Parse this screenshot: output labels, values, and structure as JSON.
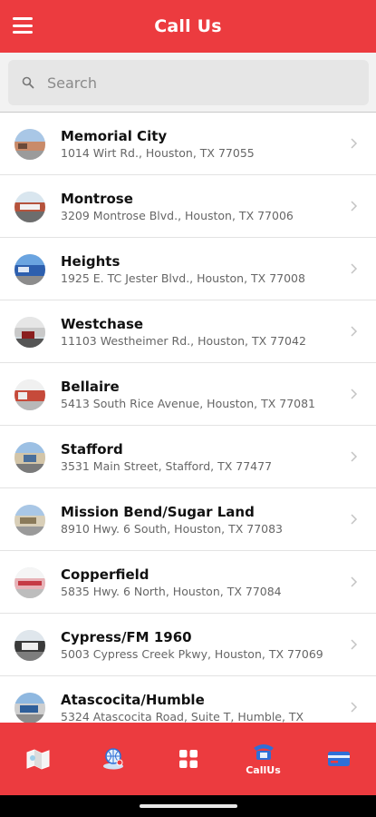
{
  "header": {
    "title": "Call Us"
  },
  "search": {
    "placeholder": "Search"
  },
  "locations": [
    {
      "name": "Memorial City",
      "address": "1014 Wirt Rd., Houston, TX 77055"
    },
    {
      "name": "Montrose",
      "address": "3209 Montrose Blvd., Houston, TX 77006"
    },
    {
      "name": "Heights",
      "address": "1925 E. TC Jester Blvd., Houston, TX 77008"
    },
    {
      "name": "Westchase",
      "address": "11103 Westheimer Rd., Houston, TX 77042"
    },
    {
      "name": "Bellaire",
      "address": "5413 South Rice Avenue, Houston, TX 77081"
    },
    {
      "name": "Stafford",
      "address": "3531 Main Street, Stafford, TX 77477"
    },
    {
      "name": "Mission Bend/Sugar Land",
      "address": "8910 Hwy. 6 South, Houston, TX 77083"
    },
    {
      "name": "Copperfield",
      "address": "5835 Hwy. 6 North, Houston, TX 77084"
    },
    {
      "name": "Cypress/FM 1960",
      "address": "5003 Cypress Creek Pkwy, Houston, TX 77069"
    },
    {
      "name": "Atascocita/Humble",
      "address": "5324 Atascocita Road, Suite T, Humble, TX"
    }
  ],
  "tabs": [
    {
      "icon": "map-icon",
      "label": ""
    },
    {
      "icon": "globe-location-icon",
      "label": ""
    },
    {
      "icon": "grid-menu-icon",
      "label": ""
    },
    {
      "icon": "phone-icon",
      "label": "CallUs"
    },
    {
      "icon": "card-icon",
      "label": ""
    }
  ],
  "colors": {
    "brand_red": "#ec3b3f",
    "accent_blue": "#2f6fd6"
  }
}
